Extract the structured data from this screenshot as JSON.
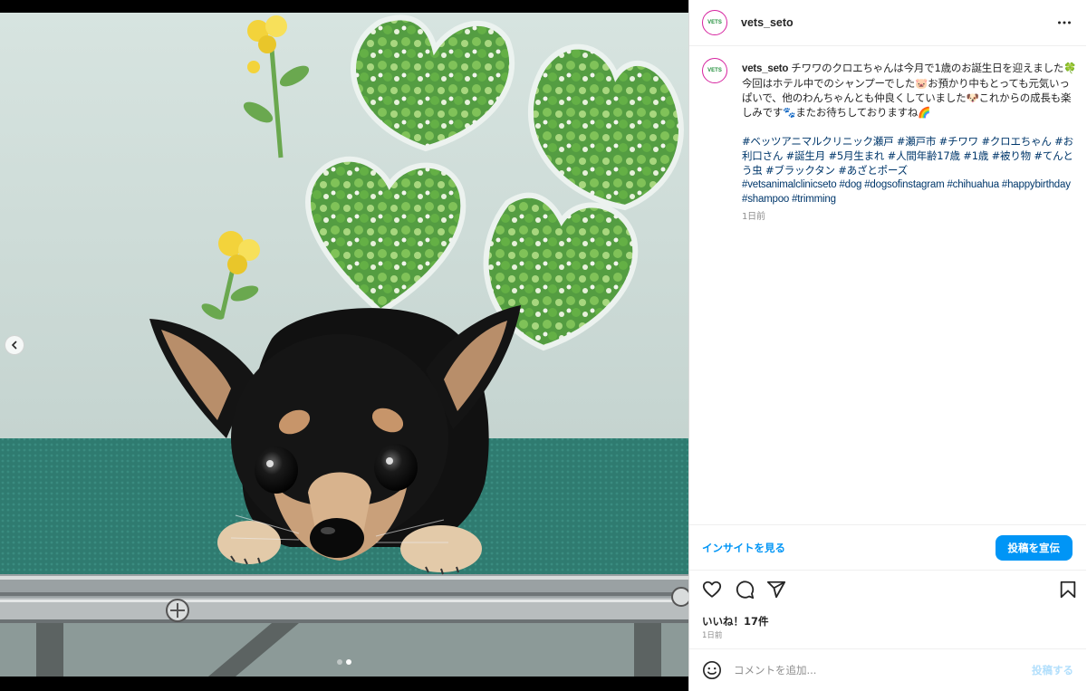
{
  "post": {
    "username": "vets_seto",
    "avatar_logo": "VETS",
    "more_icon": "more-horizontal-icon"
  },
  "caption": {
    "username": "vets_seto",
    "paragraph": "チワワのクロエちゃんは今月で1歳のお誕生日を迎えました🍀今回はホテル中でのシャンプーでした🐷お預かり中もとっても元気いっぱいで、他のわんちゃんとも仲良くしていました🐶これからの成長も楽しみです🐾またお待ちしておりますね🌈",
    "hashtags_jp": "#ベッツアニマルクリニック瀬戸 #瀬戸市 #チワワ #クロエちゃん #お利口さん #誕生月 #5月生まれ #人間年齢17歳 #1歳 #被り物 #てんとう虫 #ブラックタン #あざとポーズ",
    "hashtags_en": "#vetsanimalclinicseto #dog #dogsofinstagram #chihuahua #happybirthday #shampoo #trimming",
    "time": "1日前"
  },
  "insights": {
    "link": "インサイトを見る",
    "promote": "投稿を宣伝"
  },
  "actions": {
    "like_icon": "heart-icon",
    "comment_icon": "comment-icon",
    "share_icon": "send-icon",
    "save_icon": "bookmark-icon"
  },
  "likes": "いいね！17件",
  "post_time": "1日前",
  "comment": {
    "placeholder": "コメントを追加...",
    "post": "投稿する"
  },
  "carousel": {
    "total": 2,
    "active": 2
  },
  "colors": {
    "accent": "#0095f6",
    "link": "#00376b",
    "avatar_ring": "#d6249f"
  }
}
